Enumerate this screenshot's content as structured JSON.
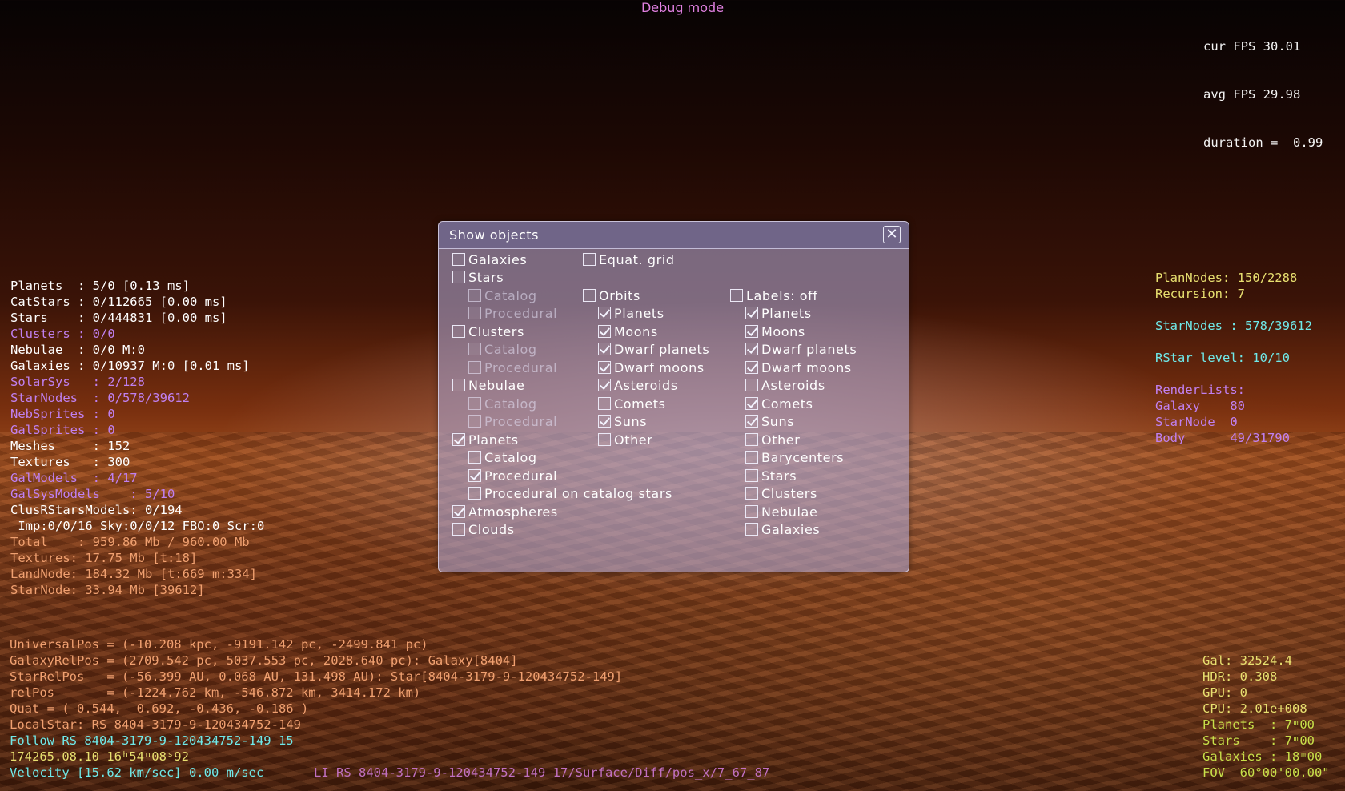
{
  "debug_title": "Debug mode",
  "fps": {
    "lines": [
      "cur FPS 30.01",
      "avg FPS 29.98",
      "duration =  0.99"
    ]
  },
  "stats_left": [
    {
      "text": "Planets  : 5/0 [0.13 ms]",
      "color": "white"
    },
    {
      "text": "CatStars : 0/112665 [0.00 ms]",
      "color": "white"
    },
    {
      "text": "Stars    : 0/444831 [0.00 ms]",
      "color": "white"
    },
    {
      "text": "Clusters : 0/0",
      "color": "violet"
    },
    {
      "text": "Nebulae  : 0/0 M:0",
      "color": "white"
    },
    {
      "text": "Galaxies : 0/10937 M:0 [0.01 ms]",
      "color": "white"
    },
    {
      "text": "SolarSys   : 2/128",
      "color": "violet"
    },
    {
      "text": "StarNodes  : 0/578/39612",
      "color": "violet"
    },
    {
      "text": "NebSprites : 0",
      "color": "violet"
    },
    {
      "text": "GalSprites : 0",
      "color": "violet"
    },
    {
      "text": "Meshes     : 152",
      "color": "white"
    },
    {
      "text": "Textures   : 300",
      "color": "white"
    },
    {
      "text": "GalModels  : 4/17",
      "color": "violet"
    },
    {
      "text": "GalSysModels    : 5/10",
      "color": "violet"
    },
    {
      "text": "ClusRStarsModels: 0/194",
      "color": "white"
    },
    {
      "text": " Imp:0/0/16 Sky:0/0/12 FBO:0 Scr:0",
      "color": "white"
    },
    {
      "text": "Total    : 959.86 Mb / 960.00 Mb",
      "color": "orange"
    },
    {
      "text": "Textures: 17.75 Mb [t:18]",
      "color": "orange"
    },
    {
      "text": "LandNode: 184.32 Mb [t:669 m:334]",
      "color": "orange"
    },
    {
      "text": "StarNode: 33.94 Mb [39612]",
      "color": "orange"
    }
  ],
  "stats_right": [
    {
      "text": "PlanNodes: 150/2288",
      "color": "yellow"
    },
    {
      "text": "Recursion: 7",
      "color": "yellow"
    },
    {
      "text": "",
      "color": "yellow"
    },
    {
      "text": "StarNodes : 578/39612",
      "color": "cyan"
    },
    {
      "text": "",
      "color": "yellow"
    },
    {
      "text": "RStar level: 10/10",
      "color": "cyan"
    },
    {
      "text": "",
      "color": "yellow"
    },
    {
      "text": "RenderLists:",
      "color": "violet"
    },
    {
      "text": "Galaxy    80",
      "color": "violet"
    },
    {
      "text": "StarNode  0",
      "color": "violet"
    },
    {
      "text": "Body      49/31790",
      "color": "violet"
    }
  ],
  "coords": [
    {
      "text": "UniversalPos = (-10.208 kpc, -9191.142 pc, -2499.841 pc)",
      "color": "orange"
    },
    {
      "text": "GalaxyRelPos = (2709.542 pc, 5037.553 pc, 2028.640 pc): Galaxy[8404]",
      "color": "orange"
    },
    {
      "text": "StarRelPos   = (-56.399 AU, 0.068 AU, 131.498 AU): Star[8404-3179-9-120434752-149]",
      "color": "orange"
    },
    {
      "text": "relPos       = (-1224.762 km, -546.872 km, 3414.172 km)",
      "color": "orange"
    },
    {
      "text": "Quat = ( 0.544,  0.692, -0.436, -0.186 )",
      "color": "orange"
    },
    {
      "text": "LocalStar: RS 8404-3179-9-120434752-149",
      "color": "orange"
    },
    {
      "text": "Follow RS 8404-3179-9-120434752-149 15",
      "color": "cyan"
    },
    {
      "text": "174265.08.10 16ʰ54ⁿ08ˢ92",
      "color": "yellow"
    },
    {
      "text": "Velocity [15.62 km/sec] 0.00 m/sec",
      "color": "cyan"
    }
  ],
  "li_path": "LI RS 8404-3179-9-120434752-149 17/Surface/Diff/pos_x/7_67_87",
  "bottom_right": [
    {
      "text": "Gal: 32524.4",
      "color": "yellow"
    },
    {
      "text": "HDR: 0.308",
      "color": "yellow"
    },
    {
      "text": "GPU: 0",
      "color": "yellow"
    },
    {
      "text": "CPU: 2.01e+008",
      "color": "yellow"
    },
    {
      "text": "Planets  : 7ᵐ00",
      "color": "yellowgreen"
    },
    {
      "text": "Stars    : 7ᵐ00",
      "color": "yellowgreen"
    },
    {
      "text": "Galaxies : 18ᵐ00",
      "color": "yellowgreen"
    },
    {
      "text": "FOV  60°00'00.00\"",
      "color": "yellowgreen"
    }
  ],
  "dialog": {
    "title": "Show objects",
    "close_glyph": "✕",
    "options": [
      {
        "id": "galaxies",
        "label": "Galaxies",
        "checked": false,
        "dim": false
      },
      {
        "id": "equat-grid",
        "label": "Equat. grid",
        "checked": false,
        "dim": false
      },
      {
        "id": "stars",
        "label": "Stars",
        "checked": false,
        "dim": false
      },
      {
        "id": "stars-catalog",
        "label": "Catalog",
        "checked": false,
        "dim": true
      },
      {
        "id": "orbits",
        "label": "Orbits",
        "checked": false,
        "dim": false
      },
      {
        "id": "labels",
        "label": "Labels: off",
        "checked": false,
        "dim": false
      },
      {
        "id": "stars-procedural",
        "label": "Procedural",
        "checked": false,
        "dim": true
      },
      {
        "id": "orbits-planets",
        "label": "Planets",
        "checked": true,
        "dim": false
      },
      {
        "id": "labels-planets",
        "label": "Planets",
        "checked": true,
        "dim": false
      },
      {
        "id": "clusters",
        "label": "Clusters",
        "checked": false,
        "dim": false
      },
      {
        "id": "orbits-moons",
        "label": "Moons",
        "checked": true,
        "dim": false
      },
      {
        "id": "labels-moons",
        "label": "Moons",
        "checked": true,
        "dim": false
      },
      {
        "id": "clusters-catalog",
        "label": "Catalog",
        "checked": false,
        "dim": true
      },
      {
        "id": "orbits-dwarf-planets",
        "label": "Dwarf planets",
        "checked": true,
        "dim": false
      },
      {
        "id": "labels-dwarf-planets",
        "label": "Dwarf planets",
        "checked": true,
        "dim": false
      },
      {
        "id": "clusters-procedural",
        "label": "Procedural",
        "checked": false,
        "dim": true
      },
      {
        "id": "orbits-dwarf-moons",
        "label": "Dwarf moons",
        "checked": true,
        "dim": false
      },
      {
        "id": "labels-dwarf-moons",
        "label": "Dwarf moons",
        "checked": true,
        "dim": false
      },
      {
        "id": "nebulae",
        "label": "Nebulae",
        "checked": false,
        "dim": false
      },
      {
        "id": "orbits-asteroids",
        "label": "Asteroids",
        "checked": true,
        "dim": false
      },
      {
        "id": "labels-asteroids",
        "label": "Asteroids",
        "checked": false,
        "dim": false
      },
      {
        "id": "nebulae-catalog",
        "label": "Catalog",
        "checked": false,
        "dim": true
      },
      {
        "id": "orbits-comets",
        "label": "Comets",
        "checked": false,
        "dim": false
      },
      {
        "id": "labels-comets",
        "label": "Comets",
        "checked": true,
        "dim": false
      },
      {
        "id": "nebulae-procedural",
        "label": "Procedural",
        "checked": false,
        "dim": true
      },
      {
        "id": "orbits-suns",
        "label": "Suns",
        "checked": true,
        "dim": false
      },
      {
        "id": "labels-suns",
        "label": "Suns",
        "checked": true,
        "dim": false
      },
      {
        "id": "planets",
        "label": "Planets",
        "checked": true,
        "dim": false
      },
      {
        "id": "orbits-other",
        "label": "Other",
        "checked": false,
        "dim": false
      },
      {
        "id": "labels-other",
        "label": "Other",
        "checked": false,
        "dim": false
      },
      {
        "id": "planets-catalog",
        "label": "Catalog",
        "checked": false,
        "dim": false
      },
      {
        "id": "labels-barycenters",
        "label": "Barycenters",
        "checked": false,
        "dim": false
      },
      {
        "id": "planets-procedural",
        "label": "Procedural",
        "checked": true,
        "dim": false
      },
      {
        "id": "labels-stars",
        "label": "Stars",
        "checked": false,
        "dim": false
      },
      {
        "id": "planets-procedural-on-catalog",
        "label": "Procedural on catalog stars",
        "checked": false,
        "dim": false
      },
      {
        "id": "labels-clusters",
        "label": "Clusters",
        "checked": false,
        "dim": false
      },
      {
        "id": "atmospheres",
        "label": "Atmospheres",
        "checked": true,
        "dim": false
      },
      {
        "id": "labels-nebulae",
        "label": "Nebulae",
        "checked": false,
        "dim": false
      },
      {
        "id": "clouds",
        "label": "Clouds",
        "checked": false,
        "dim": false
      },
      {
        "id": "labels-galaxies",
        "label": "Galaxies",
        "checked": false,
        "dim": false
      }
    ]
  }
}
